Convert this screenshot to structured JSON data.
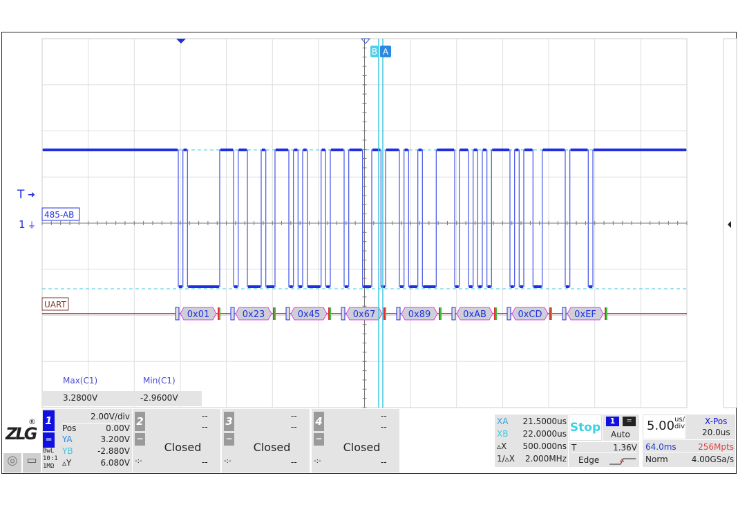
{
  "plot": {
    "channel_label": "485-AB",
    "decoder_label": "UART",
    "trigger_marker": "T",
    "channel_marker": "1",
    "cursor_b": "B",
    "cursor_a": "A",
    "decoded_bytes": [
      "0x01",
      "0x23",
      "0x45",
      "0x67",
      "0x89",
      "0xAB",
      "0xCD",
      "0xEF"
    ],
    "colors": {
      "trace": "#1f2fe0",
      "cursor": "#3cc8e0",
      "decode_outline": "#e040e0",
      "uart_line": "#7a3a30"
    }
  },
  "measurements": {
    "headers": [
      "Max(C1)",
      "Min(C1)"
    ],
    "values": [
      "3.2800V",
      "-2.9600V"
    ]
  },
  "channel1": {
    "number": "1",
    "scale": "2.00V/div",
    "pos_label": "Pos",
    "pos_value": "0.00V",
    "ya_label": "YA",
    "ya_value": "3.200V",
    "yb_label": "YB",
    "yb_value": "-2.880V",
    "dy_label": "▵Y",
    "dy_value": "6.080V",
    "coupling_icon": "dc-coupling-icon",
    "bwl": "BwL",
    "probe": "10:1",
    "impedance": "1MΩ"
  },
  "channels_closed": [
    {
      "number": "2",
      "minus": "−",
      "top1": "--",
      "top2": "--",
      "status": "Closed",
      "bottom_left": "-:-",
      "bottom_right": "--"
    },
    {
      "number": "3",
      "minus": "−",
      "top1": "--",
      "top2": "--",
      "status": "Closed",
      "bottom_left": "-:-",
      "bottom_right": "--"
    },
    {
      "number": "4",
      "minus": "−",
      "top1": "--",
      "top2": "--",
      "status": "Closed",
      "bottom_left": "-:-",
      "bottom_right": "--"
    }
  ],
  "cursors": {
    "xa_label": "XA",
    "xa_value": "21.5000us",
    "xb_label": "XB",
    "xb_value": "22.0000us",
    "dx_label": "▵X",
    "dx_value": "500.000ns",
    "inv_label": "1/▵X",
    "inv_value": "2.000MHz"
  },
  "trigger": {
    "run_state": "Stop",
    "source": "1",
    "mode": "Auto",
    "level_label": "T",
    "level_value": "1.36V",
    "type": "Edge"
  },
  "timebase": {
    "scale_value": "5.00",
    "scale_unit_top": "us/",
    "scale_unit_bottom": "div",
    "xpos_label": "X-Pos",
    "xpos_value": "20.0us",
    "record_time": "64.0ms",
    "memory_depth": "256Mpts",
    "acq_mode": "Norm",
    "sample_rate": "4.00GSa/s"
  },
  "logo": "ZLG"
}
